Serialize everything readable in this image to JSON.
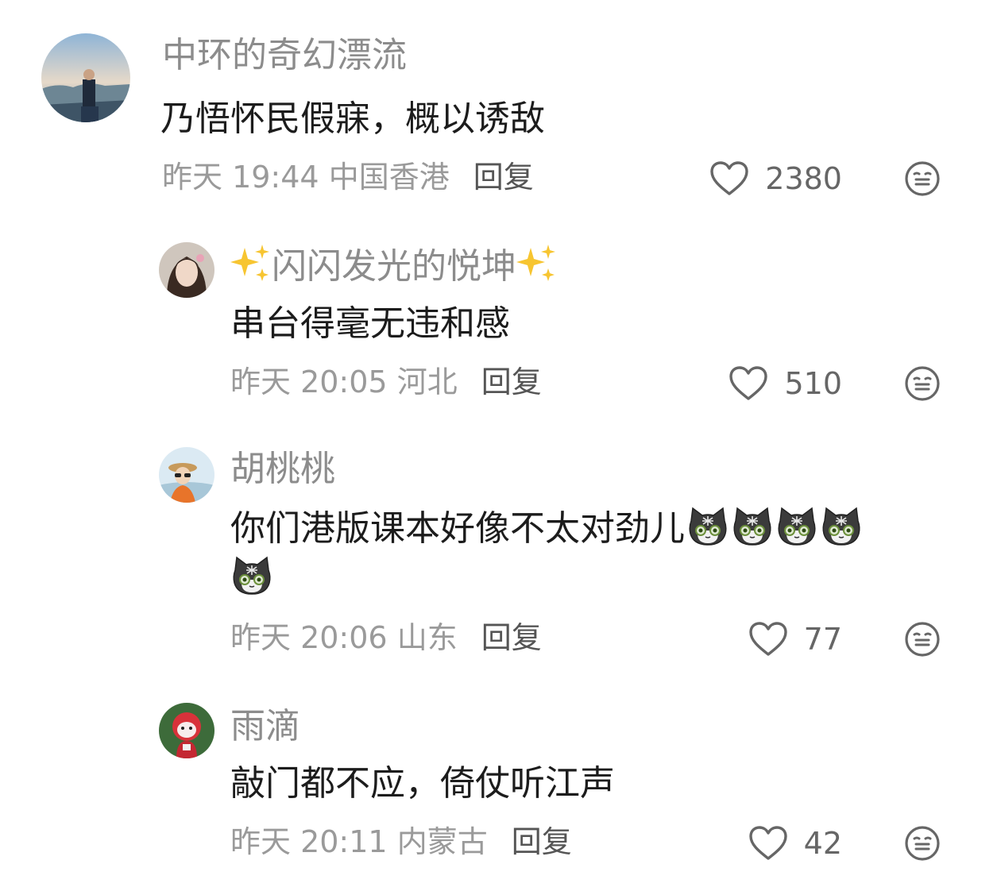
{
  "comments": [
    {
      "username": "中环的奇幻漂流",
      "text": "乃悟怀民假寐，概以诱敌",
      "time": "昨天 19:44",
      "location": "中国香港",
      "reply_label": "回复",
      "likes": "2380",
      "avatar_icon": "avatar-seaside-man"
    },
    {
      "username_prefix_icon": "sparkles-emoji",
      "username": "闪闪发光的悦坤",
      "username_suffix_icon": "sparkles-emoji",
      "text": "串台得毫无违和感",
      "time": "昨天 20:05",
      "location": "河北",
      "reply_label": "回复",
      "likes": "510",
      "avatar_icon": "avatar-woman-portrait"
    },
    {
      "username": "胡桃桃",
      "text": "你们港版课本好像不太对劲儿",
      "text_emojis": [
        "cat-emoji",
        "cat-emoji",
        "cat-emoji",
        "cat-emoji",
        "cat-emoji"
      ],
      "time": "昨天 20:06",
      "location": "山东",
      "reply_label": "回复",
      "likes": "77",
      "avatar_icon": "avatar-cartoon-girl"
    },
    {
      "username": "雨滴",
      "text": "敲门都不应，倚仗听江声",
      "time": "昨天 20:11",
      "location": "内蒙古",
      "reply_label": "回复",
      "likes": "42",
      "avatar_icon": "avatar-red-doll"
    }
  ],
  "icons": {
    "like": "heart-outline-icon",
    "dislike": "meh-face-icon"
  },
  "colors": {
    "username": "#8c8c8c",
    "content": "#1c1c1c",
    "meta": "#9a9a9a",
    "reply": "#555555",
    "icon": "#666666"
  }
}
